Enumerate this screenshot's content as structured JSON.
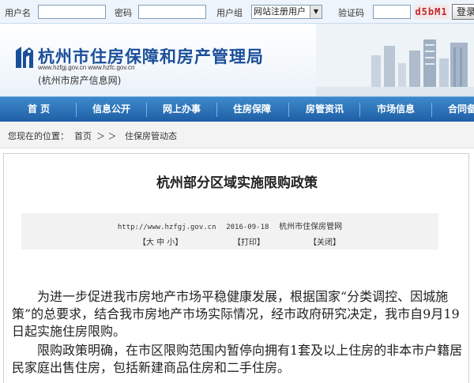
{
  "login": {
    "username_label": "用户名",
    "password_label": "密码",
    "group_label": "用户组",
    "group_selected": "网站注册用户",
    "captcha_label": "验证码",
    "captcha_value": "d5bM1",
    "login_button": "登录"
  },
  "header": {
    "title": "杭州市住房保障和房产管理局",
    "urls": "www.hzfgj.gov.cn     www.hzfc.gov.cn",
    "subtitle": "(杭州市房产信息网)"
  },
  "nav": {
    "items": [
      "首  页",
      "信息公开",
      "网上办事",
      "住房保障",
      "房管资讯",
      "市场信息",
      "合同备"
    ]
  },
  "breadcrumb": {
    "prefix": "您现在的位置：",
    "home": "首页",
    "arrows": "＞ ＞",
    "section": "住保房管动态"
  },
  "article": {
    "title": "杭州部分区域实施限购政策",
    "source_url": "http://www.hzfgj.gov.cn",
    "date": "2016-09-18",
    "publisher": "杭州市住保房管网",
    "font_sizes": "【大  中  小】",
    "print": "【打印】",
    "close": "【关闭】",
    "paragraphs": [
      "为进一步促进我市房地产市场平稳健康发展，根据国家“分类调控、因城施策”的总要求，结合我市房地产市场实际情况，经市政府研究决定，我市自9月19日起实施住房限购。",
      "限购政策明确，在市区限购范围内暂停向拥有1套及以上住房的非本市户籍居民家庭出售住房，包括新建商品住房和二手住房。"
    ]
  },
  "colors": {
    "nav_bg": "#2a6fb8",
    "title_blue": "#1a4f9a",
    "captcha_red": "#c0282e"
  }
}
